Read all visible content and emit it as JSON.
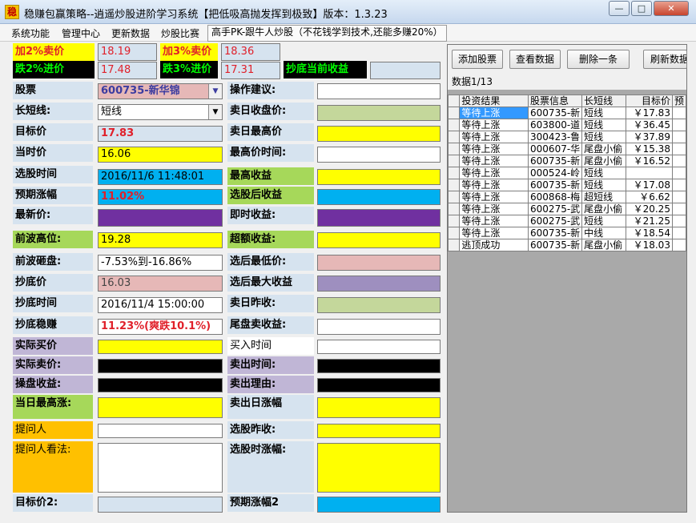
{
  "window": {
    "icon_glyph": "稳",
    "title": "稳赚包赢策略--逍遥炒股进阶学习系统【把低吸高抛发挥到极致】版本：1.3.23",
    "min_glyph": "—",
    "max_glyph": "□",
    "close_glyph": "✕"
  },
  "menu": {
    "items": [
      "系统功能",
      "管理中心",
      "更新数据",
      "炒股比赛"
    ],
    "promo": "高手PK-跟牛人炒股（不花钱学到技术,还能多赚20%）"
  },
  "prices": {
    "up2_label": "加2%卖价",
    "up2_value": "18.19",
    "down2_label": "跌2%进价",
    "down2_value": "17.48",
    "up3_label": "加3%卖价",
    "up3_value": "18.36",
    "down3_label": "跌3%进价",
    "down3_value": "17.31",
    "bottom_label": "抄底当前收益",
    "bottom_value": ""
  },
  "left_labels": [
    "股票",
    "长短线:",
    "目标价",
    "当时价",
    "选股时间",
    "预期涨幅",
    "最新价:",
    "前波高位:",
    "前波砸盘:",
    "抄底价",
    "抄底时间",
    "抄底稳赚",
    "实际买价",
    "实际卖价:",
    "操盘收益:",
    "当日最高涨:",
    "提问人",
    "提问人看法:",
    "目标价2:"
  ],
  "left_values": {
    "stock": "600735-新华锦",
    "term": "短线",
    "target_price": "17.83",
    "current_price": "16.06",
    "pick_time": "2016/11/6 11:48:01",
    "expected_rise": "11.02%",
    "latest_price": "",
    "prev_high": "19.28",
    "prev_drop": "-7.53%到-16.86%",
    "bottom_price": "16.03",
    "bottom_time": "2016/11/4 15:00:00",
    "bottom_profit": "11.23%(爽跌10.1%)"
  },
  "mid_labels": [
    "操作建议:",
    "卖日收盘价:",
    "卖日最高价",
    "最高价时间:",
    "最高收益",
    "选股后收益",
    "即时收益:",
    "超额收益:",
    "选后最低价:",
    "选后最大收益",
    "卖日昨收:",
    "尾盘卖收益:",
    "买入时间",
    "卖出时间:",
    "卖出理由:",
    "卖出日涨幅",
    "选股昨收:",
    "选股时涨幅:",
    "预期涨幅2"
  ],
  "toolbar": {
    "add": "添加股票",
    "view": "查看数据",
    "delete": "删除一条",
    "refresh": "刷新数据"
  },
  "record_count": "数据1/13",
  "grid": {
    "columns": [
      "投资结果",
      "股票信息",
      "长短线",
      "目标价",
      "预"
    ],
    "rows": [
      [
        "等待上涨",
        "600735-新",
        "短线",
        "￥17.83"
      ],
      [
        "等待上涨",
        "603800-道",
        "短线",
        "￥36.45"
      ],
      [
        "等待上涨",
        "300423-鲁",
        "短线",
        "￥37.89"
      ],
      [
        "等待上涨",
        "000607-华",
        "尾盘小偷",
        "￥15.38"
      ],
      [
        "等待上涨",
        "600735-新",
        "尾盘小偷",
        "￥16.52"
      ],
      [
        "等待上涨",
        "000524-岭",
        "短线",
        ""
      ],
      [
        "等待上涨",
        "600735-新",
        "短线",
        "￥17.08"
      ],
      [
        "等待上涨",
        "600868-梅",
        "超短线",
        "￥6.62"
      ],
      [
        "等待上涨",
        "600275-武",
        "尾盘小偷",
        "￥20.25"
      ],
      [
        "等待上涨",
        "600275-武",
        "短线",
        "￥21.25"
      ],
      [
        "等待上涨",
        "600735-新",
        "中线",
        "￥18.54"
      ],
      [
        "逃顶成功",
        "600735-新",
        "尾盘小偷",
        "￥18.03"
      ]
    ]
  },
  "colors": {
    "yellow": "#ffff00",
    "cyan": "#00b0f0",
    "purple": "#7030a0",
    "lightgreen": "#a6d85a",
    "pink": "#e6b8b7",
    "lightblue": "#d6e3ef",
    "black": "#000000",
    "gray": "#a9a9a9",
    "lavender": "#9e8fbf",
    "sage": "#c4d79b"
  }
}
